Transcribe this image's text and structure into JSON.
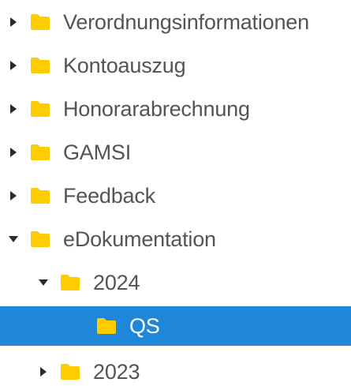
{
  "colors": {
    "folder": "#ffcc00",
    "selected_bg": "#1f86d9",
    "text": "#545454",
    "selected_text": "#ffffff",
    "arrow": "#2a2a2a"
  },
  "tree": {
    "items": [
      {
        "label": "Verordnungsinformationen",
        "state": "collapsed",
        "icon": "folder-icon"
      },
      {
        "label": "Kontoauszug",
        "state": "collapsed",
        "icon": "folder-icon"
      },
      {
        "label": "Honorarabrechnung",
        "state": "collapsed",
        "icon": "folder-icon"
      },
      {
        "label": "GAMSI",
        "state": "collapsed",
        "icon": "folder-icon"
      },
      {
        "label": "Feedback",
        "state": "collapsed",
        "icon": "folder-icon"
      },
      {
        "label": "eDokumentation",
        "state": "expanded",
        "icon": "folder-icon"
      },
      {
        "label": "2024",
        "state": "expanded",
        "icon": "folder-icon"
      },
      {
        "label": "QS",
        "state": "selected",
        "icon": "folder-icon"
      },
      {
        "label": "2023",
        "state": "collapsed",
        "icon": "folder-icon"
      }
    ]
  }
}
